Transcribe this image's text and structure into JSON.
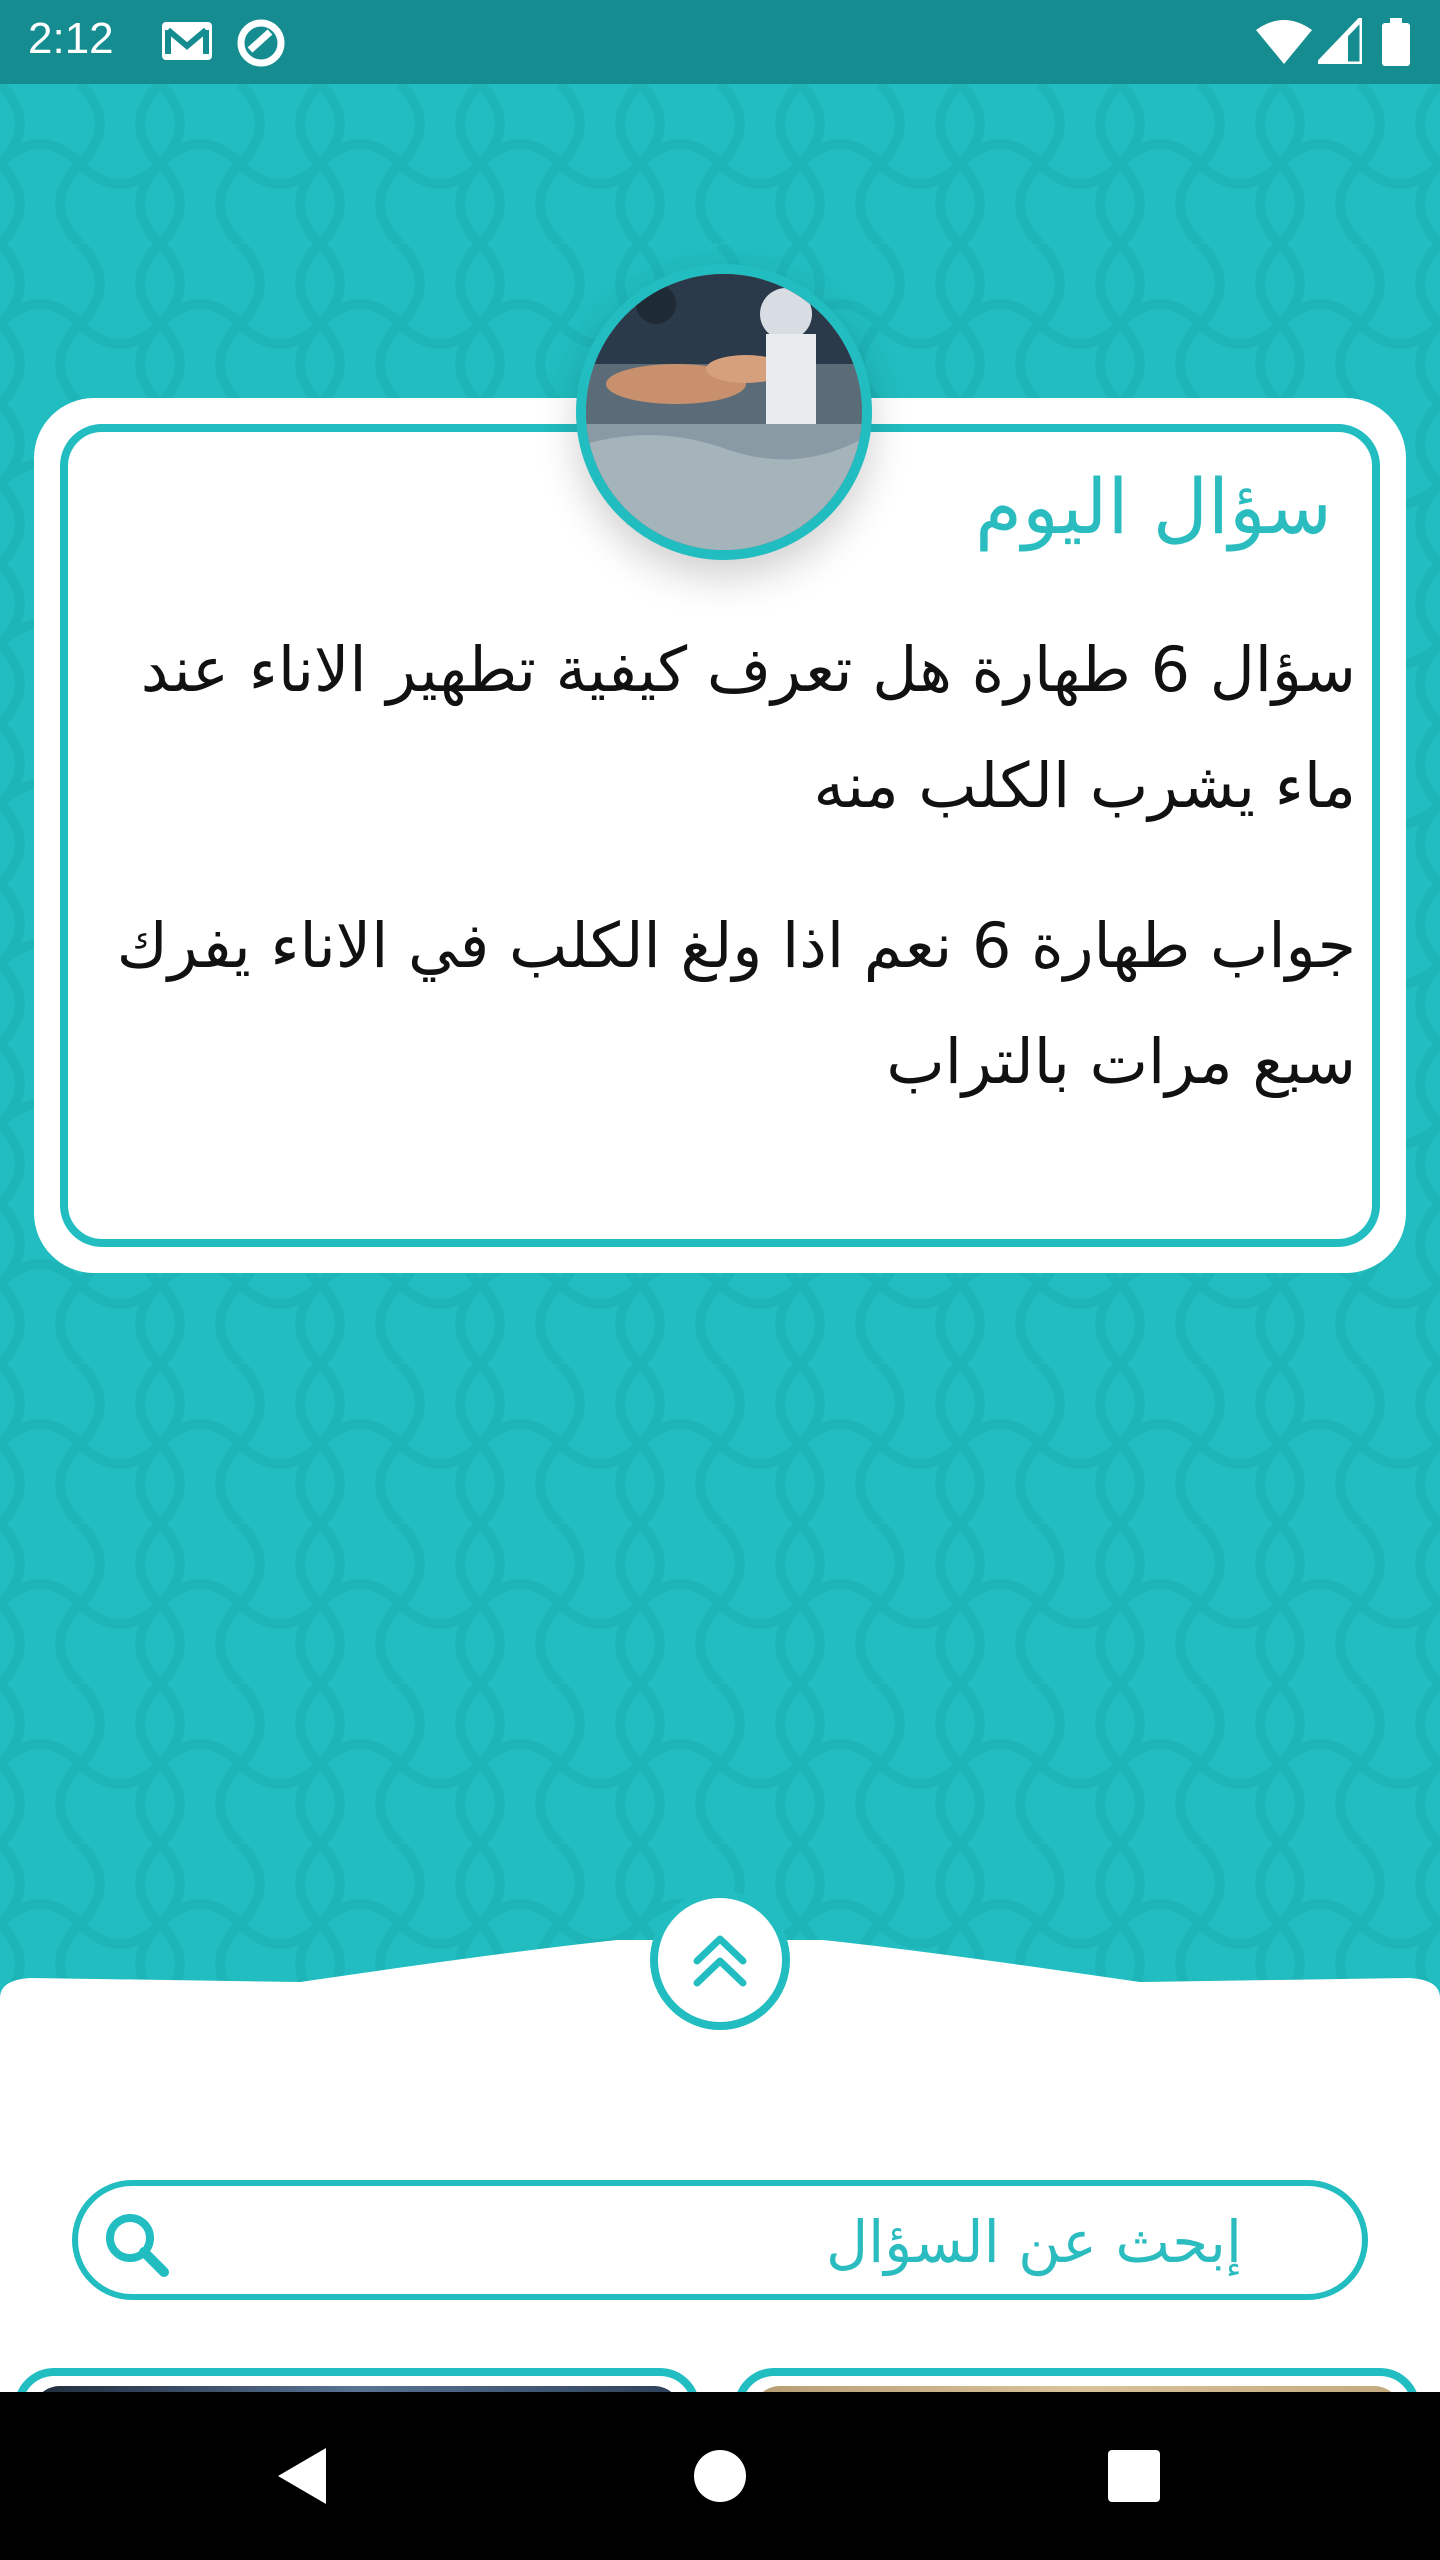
{
  "status_bar": {
    "time": "2:12",
    "icons": [
      "gmail-icon",
      "sync-icon",
      "wifi-icon",
      "signal-icon",
      "battery-icon"
    ]
  },
  "daily_card": {
    "title": "سؤال اليوم",
    "question": "سؤال 6 طهارة هل تعرف كيفية تطهير الاناء عند ماء يشرب الكلب منه",
    "answer": "جواب طهارة 6 نعم اذا ولغ الكلب في الاناء يفرك سبع مرات بالتراب"
  },
  "search": {
    "placeholder": "إبحث عن السؤال"
  },
  "nav": {
    "icons": [
      "back-icon",
      "home-icon",
      "recents-icon"
    ]
  },
  "colors": {
    "accent": "#21bdc0",
    "status_bar": "#158d90",
    "sheet": "#ffffff",
    "nav_bar": "#000000"
  }
}
